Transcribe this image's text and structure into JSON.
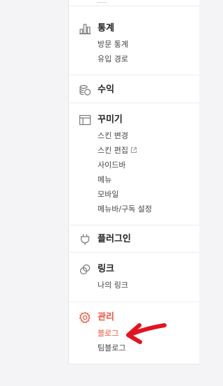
{
  "colors": {
    "accent": "#f0553c",
    "annotation_arrow": "#e3141f"
  },
  "menu": {
    "stats": {
      "title": "통계",
      "icon": "bar-chart-icon",
      "items": [
        "방문 통계",
        "유입 경로"
      ]
    },
    "revenue": {
      "title": "수익",
      "icon": "coins-icon"
    },
    "decorate": {
      "title": "꾸미기",
      "icon": "layout-icon",
      "items": [
        "스킨 변경",
        "스킨 편집",
        "사이드바",
        "메뉴",
        "모바일",
        "메뉴바/구독 설정"
      ]
    },
    "plugin": {
      "title": "플러그인",
      "icon": "plug-icon"
    },
    "link": {
      "title": "링크",
      "icon": "link-icon",
      "items": [
        "나의 링크"
      ]
    },
    "manage": {
      "title": "관리",
      "icon": "gear-icon",
      "items": [
        "블로그",
        "팀블로그"
      ],
      "active_item": "블로그"
    }
  }
}
